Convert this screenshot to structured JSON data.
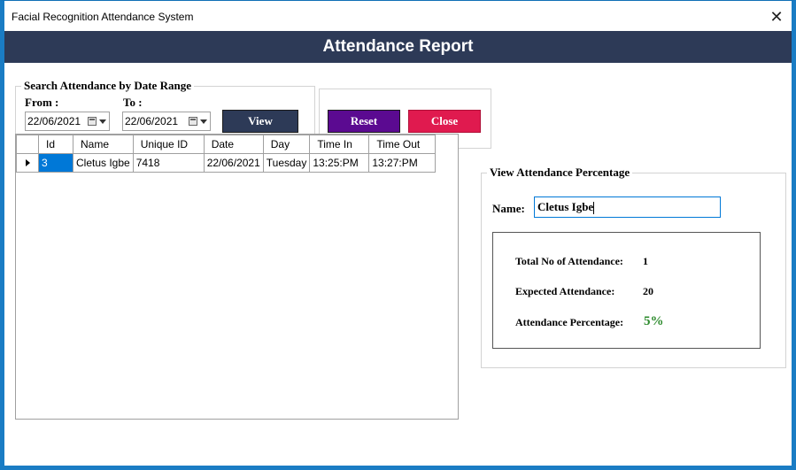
{
  "window": {
    "title": "Facial Recognition Attendance System",
    "close_glyph": "✕"
  },
  "header": {
    "title": "Attendance Report"
  },
  "search": {
    "legend": "Search Attendance by Date Range",
    "from_label": "From :",
    "to_label": "To :",
    "from_value": "22/06/2021",
    "to_value": "22/06/2021",
    "view_label": "View"
  },
  "actions": {
    "reset_label": "Reset",
    "close_label": "Close"
  },
  "grid": {
    "columns": [
      "Id",
      "Name",
      "Unique ID",
      "Date",
      "Day",
      "Time In",
      "Time Out"
    ],
    "rows": [
      [
        "3",
        "Cletus Igbe",
        "7418",
        "22/06/2021",
        "Tuesday",
        "13:25:PM",
        "13:27:PM"
      ]
    ]
  },
  "percentage": {
    "legend": "View Attendance Percentage",
    "name_label": "Name:",
    "name_value": "Cletus Igbe",
    "total_label": "Total No of Attendance:",
    "total_value": "1",
    "expected_label": "Expected Attendance:",
    "expected_value": "20",
    "percent_label": "Attendance Percentage:",
    "percent_value": "5%"
  },
  "colors": {
    "header_bg": "#2d3a57",
    "view_btn": "#2d3a57",
    "reset_btn": "#5b0a91",
    "close_btn": "#e01a4f",
    "percent_text": "#2e8b2e",
    "selection": "#0078d7"
  }
}
